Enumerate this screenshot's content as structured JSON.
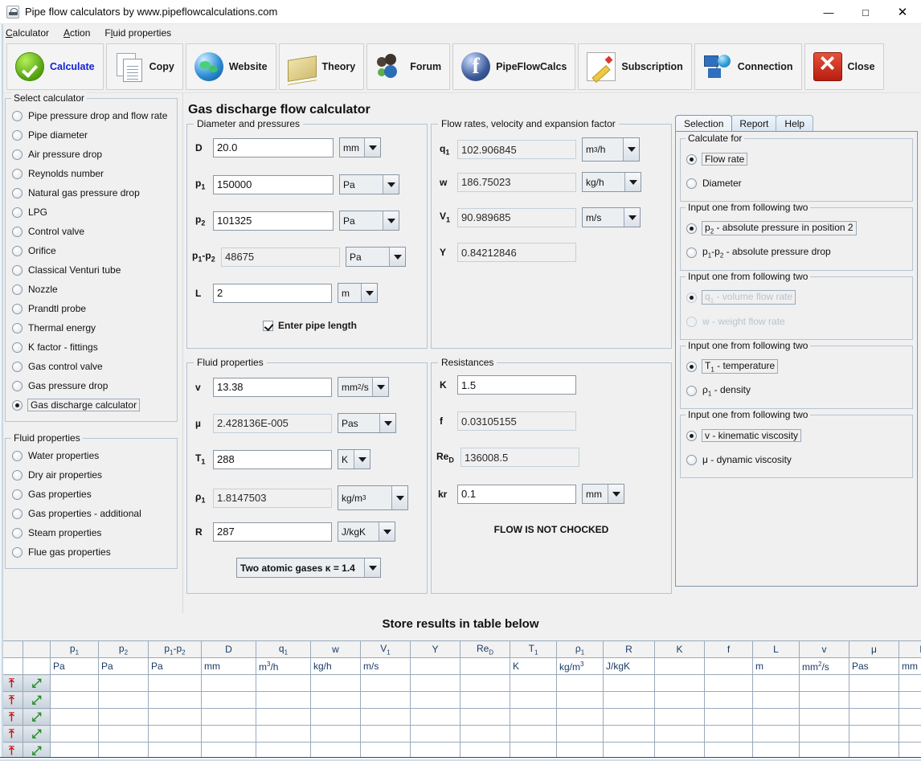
{
  "window": {
    "title": "Pipe flow calculators by www.pipeflowcalculations.com",
    "icon": "java-coffee-icon",
    "minimize": "—",
    "maximize": "□",
    "close": "✕"
  },
  "menubar": [
    {
      "label": "Calculator",
      "mnemonic": "C"
    },
    {
      "label": "Action",
      "mnemonic": "A"
    },
    {
      "label": "Fluid properties",
      "mnemonic": "l"
    }
  ],
  "toolbar": [
    {
      "label": "Calculate",
      "icon": "green-check-icon"
    },
    {
      "label": "Copy",
      "icon": "copy-documents-icon"
    },
    {
      "label": "Website",
      "icon": "globe-icon"
    },
    {
      "label": "Theory",
      "icon": "book-icon"
    },
    {
      "label": "Forum",
      "icon": "users-icon"
    },
    {
      "label": "PipeFlowCalcs",
      "icon": "facebook-icon"
    },
    {
      "label": "Subscription",
      "icon": "pencil-note-icon"
    },
    {
      "label": "Connection",
      "icon": "network-icon"
    },
    {
      "label": "Close",
      "icon": "red-x-icon"
    }
  ],
  "sidebar": {
    "calculators_title": "Select calculator",
    "calculators": [
      {
        "label": "Pipe pressure drop and flow rate",
        "selected": false
      },
      {
        "label": "Pipe diameter",
        "selected": false
      },
      {
        "label": "Air pressure drop",
        "selected": false
      },
      {
        "label": "Reynolds number",
        "selected": false
      },
      {
        "label": "Natural gas pressure drop",
        "selected": false
      },
      {
        "label": "LPG",
        "selected": false
      },
      {
        "label": "Control valve",
        "selected": false
      },
      {
        "label": "Orifice",
        "selected": false
      },
      {
        "label": "Classical Venturi tube",
        "selected": false
      },
      {
        "label": "Nozzle",
        "selected": false
      },
      {
        "label": "Prandtl probe",
        "selected": false
      },
      {
        "label": "Thermal energy",
        "selected": false
      },
      {
        "label": "K factor - fittings",
        "selected": false
      },
      {
        "label": "Gas control valve",
        "selected": false
      },
      {
        "label": "Gas pressure drop",
        "selected": false
      },
      {
        "label": "Gas discharge calculator",
        "selected": true
      }
    ],
    "fluid_title": "Fluid properties",
    "fluids": [
      {
        "label": "Water properties",
        "selected": false
      },
      {
        "label": "Dry air properties",
        "selected": false
      },
      {
        "label": "Gas properties",
        "selected": false
      },
      {
        "label": "Gas properties - additional",
        "selected": false
      },
      {
        "label": "Steam properties",
        "selected": false
      },
      {
        "label": "Flue gas properties",
        "selected": false
      }
    ]
  },
  "main": {
    "page_title": "Gas discharge flow calculator",
    "diameter_panel": {
      "title": "Diameter and pressures",
      "fields": [
        {
          "label": "D",
          "label_sub": "",
          "value": "20.0",
          "unit": "mm",
          "readonly": false
        },
        {
          "label": "p",
          "label_sub": "1",
          "value": "150000",
          "unit": "Pa",
          "readonly": false
        },
        {
          "label": "p",
          "label_sub": "2",
          "value": "101325",
          "unit": "Pa",
          "readonly": false
        },
        {
          "label": "p₁-p₂",
          "label_sub": "",
          "value": "48675",
          "unit": "Pa",
          "readonly": true
        },
        {
          "label": "L",
          "label_sub": "",
          "value": "2",
          "unit": "m",
          "readonly": false
        }
      ],
      "checkbox": {
        "label": "Enter pipe length",
        "checked": true
      }
    },
    "flow_panel": {
      "title": "Flow rates, velocity and expansion factor",
      "fields": [
        {
          "label": "q",
          "label_sub": "1",
          "value": "102.906845",
          "unit": "m³/h",
          "readonly": true
        },
        {
          "label": "w",
          "label_sub": "",
          "value": "186.75023",
          "unit": "kg/h",
          "readonly": true
        },
        {
          "label": "V",
          "label_sub": "1",
          "value": "90.989685",
          "unit": "m/s",
          "readonly": true
        },
        {
          "label": "Y",
          "label_sub": "",
          "value": "0.84212846",
          "unit": "",
          "readonly": true
        }
      ]
    },
    "fluid_panel": {
      "title": "Fluid properties",
      "fields": [
        {
          "label": "v",
          "label_sub": "",
          "value": "13.38",
          "unit": "mm²/s",
          "readonly": false
        },
        {
          "label": "μ",
          "label_sub": "",
          "value": "2.428136E-005",
          "unit": "Pas",
          "readonly": true
        },
        {
          "label": "T",
          "label_sub": "1",
          "value": "288",
          "unit": "K",
          "readonly": false
        },
        {
          "label": "ρ",
          "label_sub": "1",
          "value": "1.8147503",
          "unit": "kg/m³",
          "readonly": true
        },
        {
          "label": "R",
          "label_sub": "",
          "value": "287",
          "unit": "J/kgK",
          "readonly": false
        }
      ],
      "gas_select": "Two atomic gases κ = 1.4"
    },
    "resistances_panel": {
      "title": "Resistances",
      "fields": [
        {
          "label": "K",
          "label_sub": "",
          "value": "1.5",
          "unit": "",
          "readonly": false
        },
        {
          "label": "f",
          "label_sub": "",
          "value": "0.03105155",
          "unit": "",
          "readonly": true
        },
        {
          "label": "Re",
          "label_sub": "D",
          "value": "136008.5",
          "unit": "",
          "readonly": true
        },
        {
          "label": "kr",
          "label_sub": "",
          "value": "0.1",
          "unit": "mm",
          "readonly": false
        }
      ],
      "status": "FLOW IS NOT CHOCKED"
    }
  },
  "right_panel": {
    "tabs": [
      {
        "label": "Selection",
        "active": true
      },
      {
        "label": "Report",
        "active": false
      },
      {
        "label": "Help",
        "active": false
      }
    ],
    "groups": [
      {
        "title": "Calculate for",
        "disabled": false,
        "options": [
          {
            "label": "Flow rate",
            "selected": true
          },
          {
            "label": "Diameter",
            "selected": false
          }
        ]
      },
      {
        "title": "Input one from following two",
        "disabled": false,
        "options": [
          {
            "label": "p₂ - absolute pressure in position 2",
            "selected": true
          },
          {
            "label": "p₁-p₂ - absolute pressure drop",
            "selected": false
          }
        ]
      },
      {
        "title": "Input one from following two",
        "disabled": true,
        "options": [
          {
            "label": "q₁ - volume flow rate",
            "selected": true
          },
          {
            "label": "w - weight flow rate",
            "selected": false
          }
        ]
      },
      {
        "title": "Input one from following two",
        "disabled": false,
        "options": [
          {
            "label": "T₁ - temperature",
            "selected": true
          },
          {
            "label": "ρ₁ - density",
            "selected": false
          }
        ]
      },
      {
        "title": "Input one from following two",
        "disabled": false,
        "options": [
          {
            "label": "v - kinematic viscosity",
            "selected": true
          },
          {
            "label": "μ - dynamic viscosity",
            "selected": false
          }
        ]
      }
    ]
  },
  "results_table": {
    "title": "Store results in table below",
    "columns": [
      {
        "header": "",
        "unit": ""
      },
      {
        "header": "",
        "unit": ""
      },
      {
        "header": "p₁",
        "unit": "Pa"
      },
      {
        "header": "p₂",
        "unit": "Pa"
      },
      {
        "header": "p₁-p₂",
        "unit": "Pa"
      },
      {
        "header": "D",
        "unit": "mm"
      },
      {
        "header": "q₁",
        "unit": "m³/h"
      },
      {
        "header": "w",
        "unit": "kg/h"
      },
      {
        "header": "V₁",
        "unit": "m/s"
      },
      {
        "header": "Y",
        "unit": ""
      },
      {
        "header": "Reᴅ",
        "unit": ""
      },
      {
        "header": "T₁",
        "unit": "K"
      },
      {
        "header": "ρ₁",
        "unit": "kg/m³"
      },
      {
        "header": "R",
        "unit": "J/kgK"
      },
      {
        "header": "K",
        "unit": ""
      },
      {
        "header": "f",
        "unit": ""
      },
      {
        "header": "L",
        "unit": "m"
      },
      {
        "header": "v",
        "unit": "mm²/s"
      },
      {
        "header": "μ",
        "unit": "Pas"
      },
      {
        "header": "kr",
        "unit": "mm"
      }
    ],
    "row_count": 5,
    "store_icon": "red-up-arrow-icon",
    "recall_icon": "green-down-arrow-icon"
  }
}
